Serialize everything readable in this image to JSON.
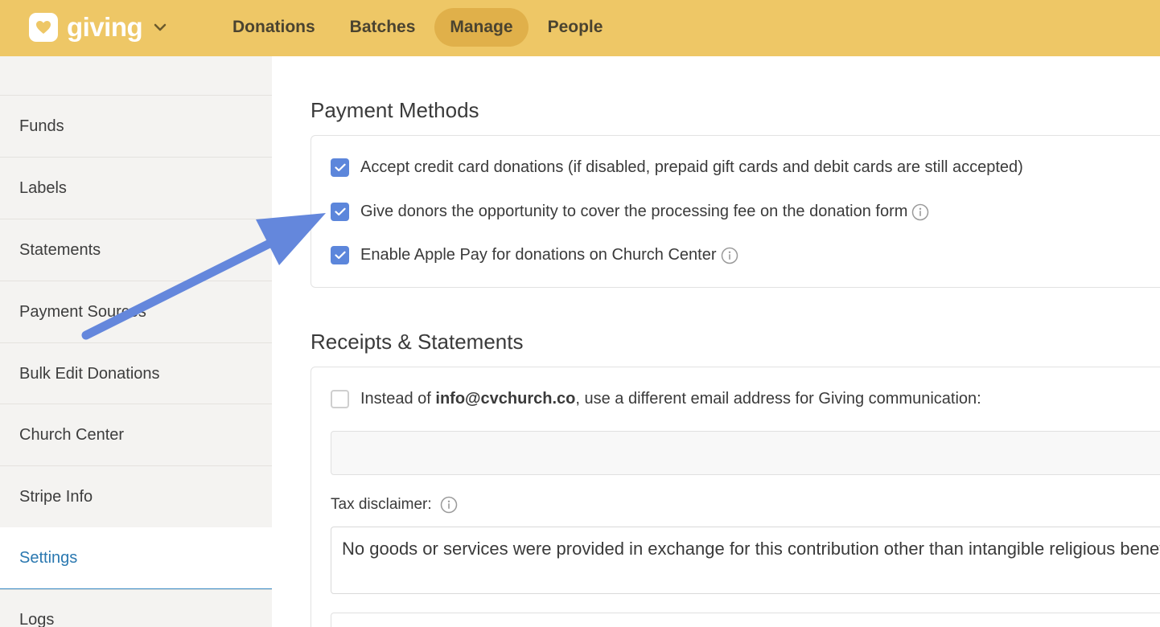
{
  "header": {
    "app_name": "giving",
    "nav": [
      {
        "label": "Donations",
        "active": false
      },
      {
        "label": "Batches",
        "active": false
      },
      {
        "label": "Manage",
        "active": true
      },
      {
        "label": "People",
        "active": false
      }
    ],
    "colors": {
      "bar": "#eec766",
      "active_pill": "#e0b04a"
    }
  },
  "sidebar": {
    "items": [
      {
        "label": "Funds"
      },
      {
        "label": "Labels"
      },
      {
        "label": "Statements"
      },
      {
        "label": "Payment Sources"
      },
      {
        "label": "Bulk Edit Donations"
      },
      {
        "label": "Church Center"
      },
      {
        "label": "Stripe Info"
      },
      {
        "label": "Settings",
        "active": true
      },
      {
        "label": "Logs"
      }
    ]
  },
  "payment_methods": {
    "title": "Payment Methods",
    "options": [
      {
        "label": "Accept credit card donations (if disabled, prepaid gift cards and debit cards are still accepted)",
        "checked": true,
        "info": false
      },
      {
        "label": "Give donors the opportunity to cover the processing fee on the donation form",
        "checked": true,
        "info": true
      },
      {
        "label": "Enable Apple Pay for donations on Church Center",
        "checked": true,
        "info": true
      }
    ]
  },
  "receipts": {
    "title": "Receipts & Statements",
    "email_option": {
      "prefix": "Instead of ",
      "email": "info@cvchurch.co",
      "suffix": ", use a different email address for Giving communication:",
      "checked": false
    },
    "email_input_value": "",
    "tax_label": "Tax disclaimer:",
    "tax_text": "No goods or services were provided in exchange for this contribution other than intangible religious benefits."
  },
  "icons": {
    "logo": "heart-icon",
    "dropdown": "chevron-down-icon",
    "check": "check-icon",
    "info": "info-icon",
    "annotation": "annotation-arrow"
  },
  "accent_colors": {
    "checkbox": "#5c86db",
    "arrow": "#6487dc",
    "active_link": "#2a78b0"
  }
}
